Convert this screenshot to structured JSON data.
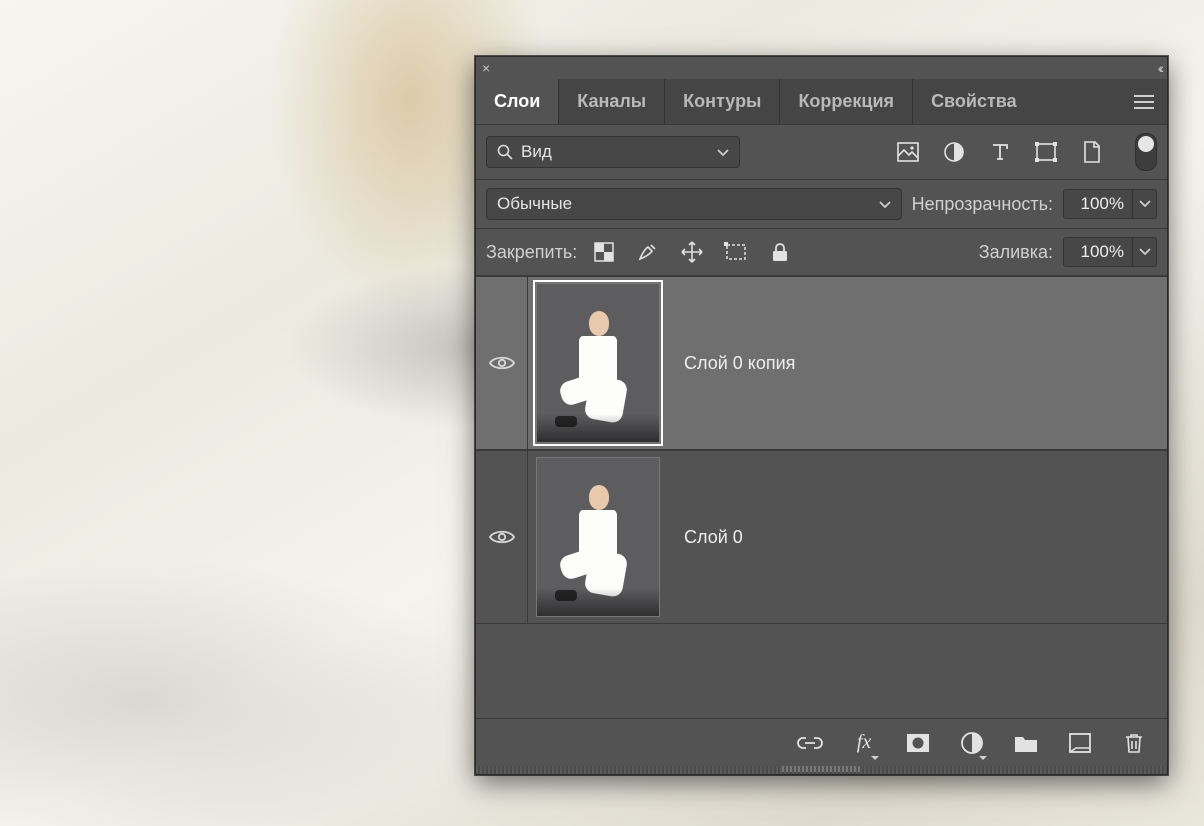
{
  "tabs": {
    "layers": "Слои",
    "channels": "Каналы",
    "paths": "Контуры",
    "adjust": "Коррекция",
    "props": "Свойства"
  },
  "row_filter": {
    "search_icon": "search-icon",
    "kind_label": "Вид"
  },
  "row_blend": {
    "mode": "Обычные",
    "opacity_label": "Непрозрачность:",
    "opacity_value": "100%"
  },
  "row_lock": {
    "lock_label": "Закрепить:",
    "fill_label": "Заливка:",
    "fill_value": "100%"
  },
  "layers": [
    {
      "name": "Слой 0 копия",
      "selected": true,
      "visible": true
    },
    {
      "name": "Слой 0",
      "selected": false,
      "visible": true
    }
  ]
}
